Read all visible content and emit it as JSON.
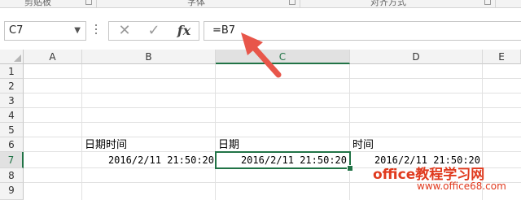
{
  "ribbon": {
    "groups": [
      "剪贴板",
      "字体",
      "对齐方式"
    ]
  },
  "formula_bar": {
    "name_box": "C7",
    "cancel_icon": "✕",
    "enter_icon": "✓",
    "fx_label": "fx",
    "formula": "=B7"
  },
  "columns": [
    "A",
    "B",
    "C",
    "D",
    "E"
  ],
  "rows": [
    "1",
    "2",
    "3",
    "4",
    "5",
    "6",
    "7",
    "8",
    "9"
  ],
  "cells": {
    "B6": "日期时间",
    "C6": "日期",
    "D6": "时间",
    "B7": "2016/2/11  21:50:20",
    "C7": "2016/2/11  21:50:20",
    "D7": "2016/2/11  21:50:20"
  },
  "selected_cell": "C7",
  "colors": {
    "accent": "#217346",
    "arrow": "#e8564a",
    "watermark": "#e03a1e"
  },
  "watermark": {
    "line1": "office教程学习网",
    "line2": "www.office68.com"
  }
}
